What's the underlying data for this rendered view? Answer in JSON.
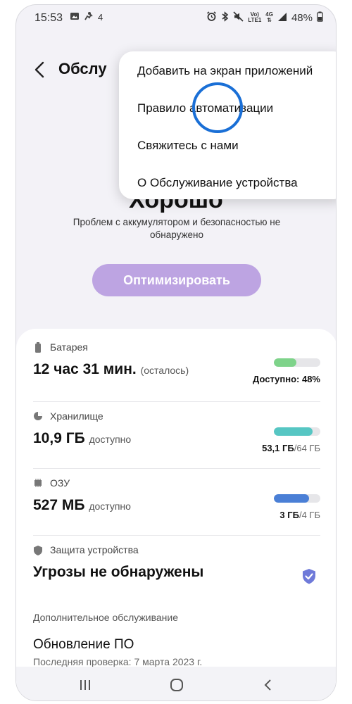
{
  "status_bar": {
    "time": "15:53",
    "signal_label": "4",
    "vo_label_top": "Vo)",
    "vo_label_bottom": "LTE1",
    "net_label": "4G",
    "battery_percent": "48%"
  },
  "header": {
    "title": "Обслу"
  },
  "overview": {
    "status": "Хорошо",
    "subtitle": "Проблем с аккумулятором и безопасностью не обнаружено",
    "optimize_label": "Оптимизировать"
  },
  "battery": {
    "label": "Батарея",
    "value": "12 час 31 мин.",
    "value_suffix": "(осталось)",
    "available_text": "Доступно: 48%",
    "level": 0.48,
    "color": "#7ed38a"
  },
  "storage": {
    "label": "Хранилище",
    "value": "10,9 ГБ",
    "value_suffix": "доступно",
    "used": "53,1 ГБ",
    "total": "/64 ГБ",
    "level": 0.83,
    "color": "#56c6c3"
  },
  "ram": {
    "label": "ОЗУ",
    "value": "527 МБ",
    "value_suffix": "доступно",
    "used": "3 ГБ",
    "total": "/4 ГБ",
    "level": 0.75,
    "color": "#4a7fd6"
  },
  "security": {
    "label": "Защита устройства",
    "value": "Угрозы не обнаружены",
    "shield_color": "#6f7ad9"
  },
  "additional": {
    "label": "Дополнительное обслуживание",
    "update_title": "Обновление ПО",
    "update_sub": "Последняя проверка: 7 марта 2023 г."
  },
  "menu": {
    "items": [
      "Добавить на экран приложений",
      "Правило автоматизации",
      "Свяжитесь с нами",
      "О Обслуживание устройства"
    ]
  },
  "colors": {
    "accent": "#bda4e2",
    "touch_indicator": "#1a6fd6"
  }
}
